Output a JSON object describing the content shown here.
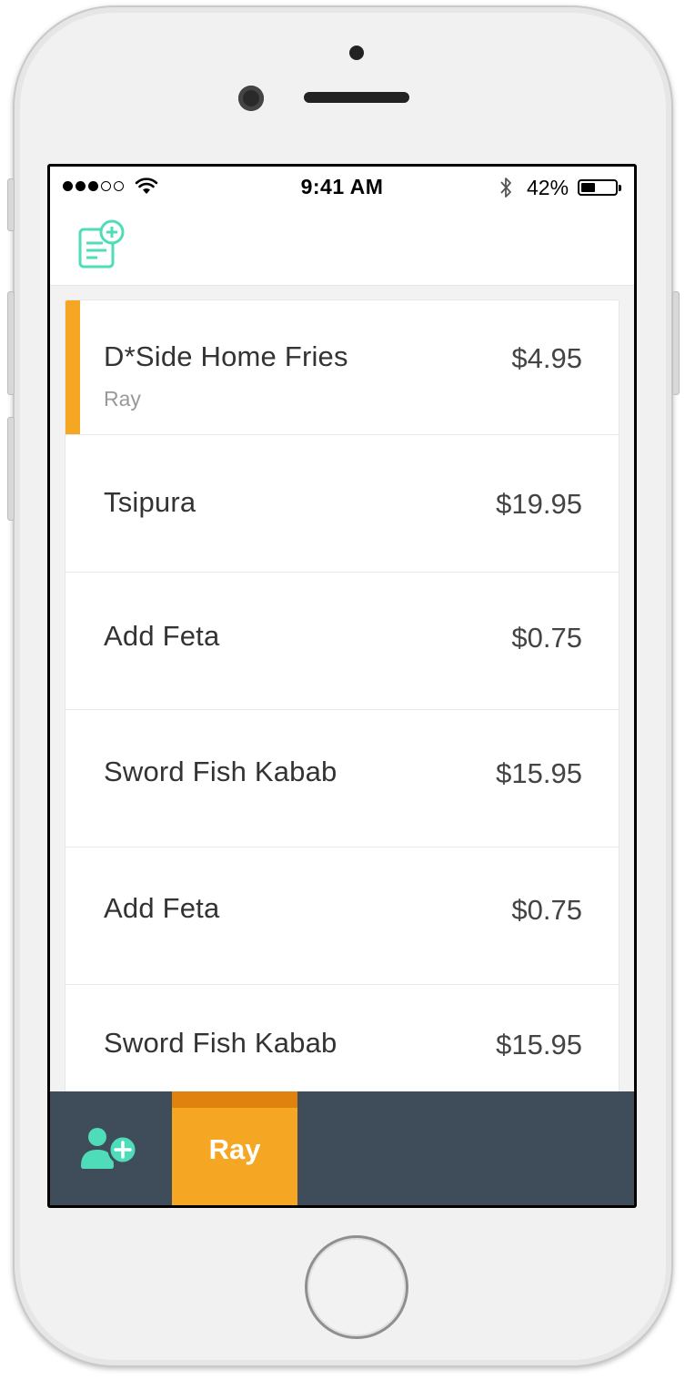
{
  "statusbar": {
    "time": "9:41 AM",
    "battery_percent": "42%",
    "battery_level": 0.42,
    "signal_bars_filled": 3,
    "signal_bars_total": 5
  },
  "toolbar": {
    "new_order_icon": "document-add-icon"
  },
  "items": [
    {
      "name": "D*Side Home Fries",
      "price": "$4.95",
      "guest": "Ray",
      "selected": true
    },
    {
      "name": "Tsipura",
      "price": "$19.95",
      "guest": "",
      "selected": false
    },
    {
      "name": "Add Feta",
      "price": "$0.75",
      "guest": "",
      "selected": false
    },
    {
      "name": "Sword Fish Kabab",
      "price": "$15.95",
      "guest": "",
      "selected": false
    },
    {
      "name": "Add Feta",
      "price": "$0.75",
      "guest": "",
      "selected": false
    },
    {
      "name": "Sword Fish Kabab",
      "price": "$15.95",
      "guest": "",
      "selected": false
    }
  ],
  "bottombar": {
    "add_guest_icon": "add-user-icon",
    "guests": [
      {
        "label": "Ray",
        "active": true
      }
    ]
  },
  "colors": {
    "accent": "#f5a623",
    "accent_dark": "#e0830e",
    "icon_teal": "#4fdcb8",
    "bottombar_bg": "#3f4c59"
  }
}
